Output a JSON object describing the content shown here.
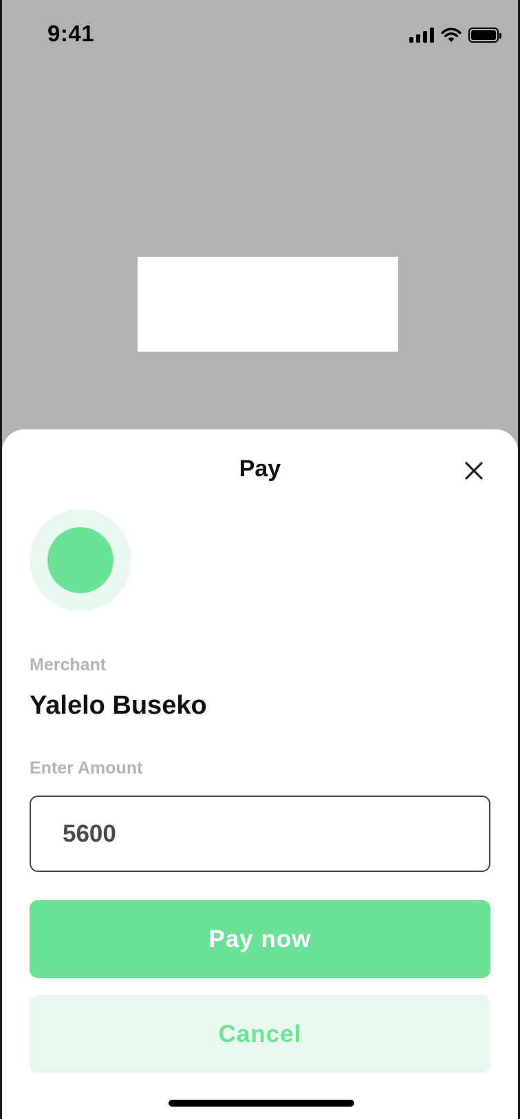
{
  "status_bar": {
    "time": "9:41",
    "icons": [
      "signal-icon",
      "wifi-icon",
      "battery-icon"
    ]
  },
  "sheet": {
    "title": "Pay",
    "close_icon": "close-icon",
    "merchant_label": "Merchant",
    "merchant_name": "Yalelo Buseko",
    "amount_label": "Enter Amount",
    "amount_value": "5600",
    "pay_button_label": "Pay now",
    "cancel_button_label": "Cancel"
  },
  "colors": {
    "accent": "#6ae396",
    "accent_light": "#e8f8ef",
    "overlay": "#b2b2b2",
    "muted_text": "#b4b4b4"
  }
}
